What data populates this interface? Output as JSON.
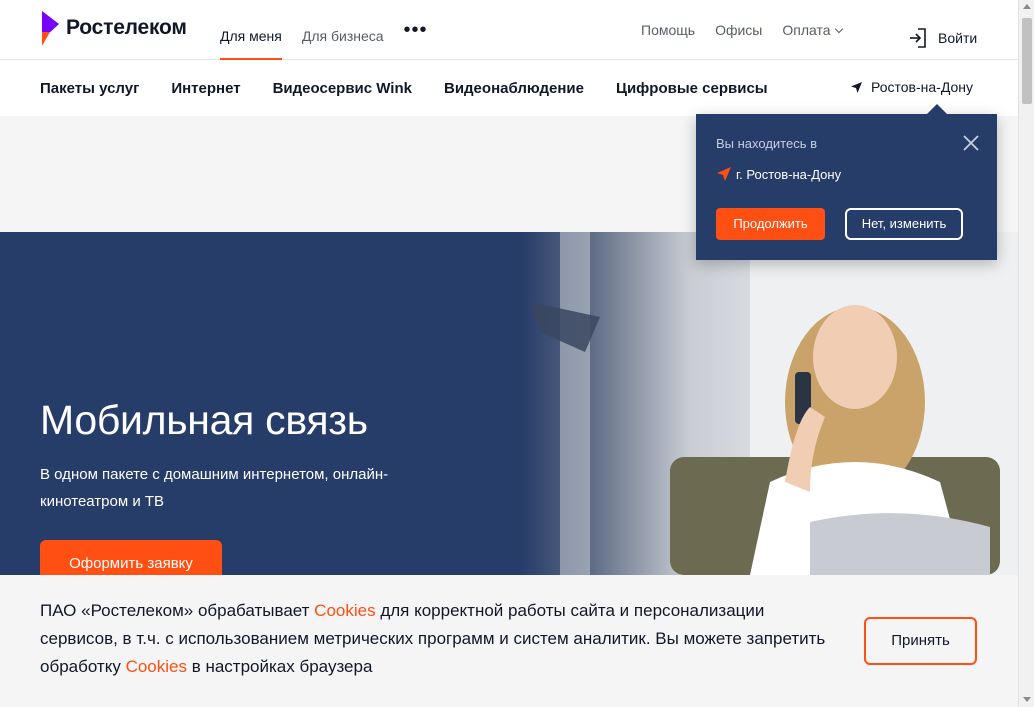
{
  "colors": {
    "brand_orange": "#ff4f12",
    "brand_purple": "#7700ff",
    "navy": "#263c69",
    "text": "#101828",
    "muted": "#575d68"
  },
  "header": {
    "logo_text": "Ростелеком",
    "segments": [
      {
        "label": "Для меня",
        "active": true
      },
      {
        "label": "Для бизнеса",
        "active": false
      }
    ],
    "more_icon": "more-dots-icon",
    "utility_links": [
      "Помощь",
      "Офисы",
      "Оплата"
    ],
    "login_label": "Войти",
    "login_icon": "login-icon"
  },
  "category_nav": {
    "items": [
      "Пакеты услуг",
      "Интернет",
      "Видеосервис Wink",
      "Видеонаблюдение",
      "Цифровые сервисы"
    ],
    "region": "Ростов-на-Дону",
    "region_icon": "location-arrow-icon"
  },
  "hero": {
    "title": "Мобильная связь",
    "subtitle": "В одном пакете с домашним интернетом, онлайн-кинотеатром и ТВ",
    "cta": "Оформить заявку"
  },
  "location_popup": {
    "label": "Вы находитесь в",
    "city": "г. Ростов-на-Дону",
    "continue_label": "Продолжить",
    "change_label": "Нет, изменить",
    "close_icon": "close-icon"
  },
  "cookie_banner": {
    "text_1": "ПАО «Ростелеком» обрабатывает ",
    "link_1": "Cookies",
    "text_2": " для корректной работы сайта и персонализации сервисов, в т.ч. с использованием метрических программ и систем аналитик. Вы можете запретить обработку ",
    "link_2": "Cookies",
    "text_3": " в настройках браузера",
    "accept_label": "Принять"
  }
}
